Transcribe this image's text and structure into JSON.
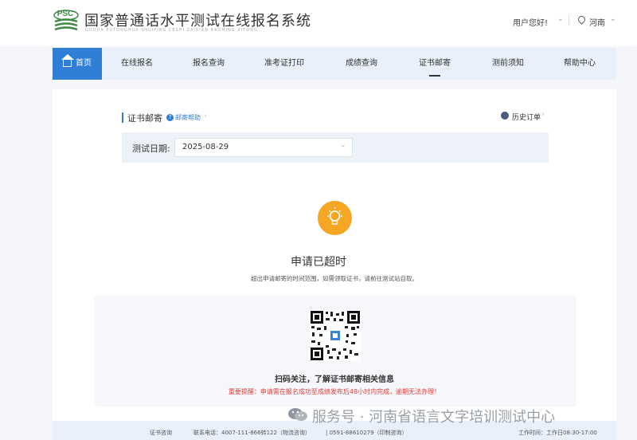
{
  "header": {
    "logo_text": "PSC",
    "title": "国家普通话水平测试在线报名系统",
    "subtitle": "GUOJIA PUTONGHUA SHUIPING CESHI ZAIXIAN BAOMING XITONG",
    "user_greeting": "用户您好!",
    "location": "河南"
  },
  "nav": {
    "home": "首页",
    "items": [
      "在线报名",
      "报名查询",
      "准考证打印",
      "成绩查询",
      "证书邮寄",
      "测前须知",
      "帮助中心"
    ],
    "active": "证书邮寄"
  },
  "section": {
    "title": "证书邮寄",
    "help_link": "邮寄帮助",
    "history_link": "历史订单"
  },
  "date_filter": {
    "label": "测试日期:",
    "value": "2025-08-29"
  },
  "status": {
    "title": "申请已超时",
    "description": "超出申请邮寄的时间范围，如需领取证书，请前往测试站自取。"
  },
  "qr": {
    "caption": "扫码关注，了解证书邮寄相关信息",
    "warning": "重要提醒：申请需在报名成功至成绩发布后48小时内完成，逾期无法办理！"
  },
  "footer": {
    "consult": "证书咨询",
    "phone": "联系电话：4007-111-866转122（物流咨询）",
    "phone2": "| 0591-88610279（印制咨询）",
    "hours": "工作时间：工作日08:30-17:00"
  },
  "watermark": "服务号 · 河南省语言文字培训测试中心",
  "colors": {
    "primary": "#2f7fd7",
    "warning": "#e0413d",
    "bulb": "#f5a623"
  }
}
